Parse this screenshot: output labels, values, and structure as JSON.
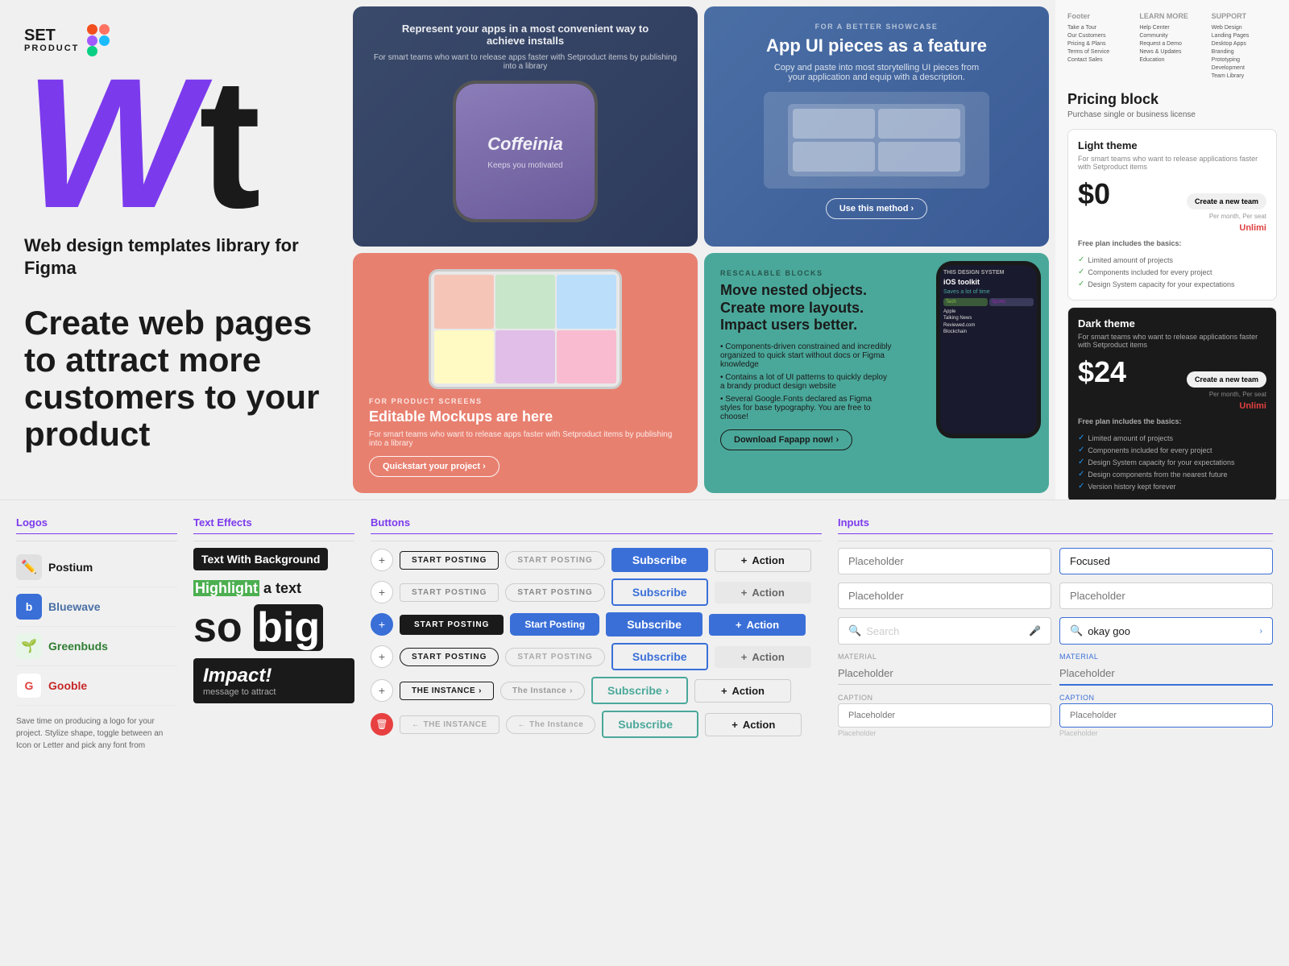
{
  "brand": {
    "name": "SET",
    "subtitle": "PRODUCT",
    "big_w": "W",
    "big_t": "t",
    "tagline": "Web design templates library for Figma",
    "cta": "Create web pages to attract more customers to your product"
  },
  "cards": [
    {
      "id": "card-apps",
      "label": "",
      "title": "Represent your apps in a most convenient way to achieve installs",
      "desc": "For smart teams who want to release apps faster with Setproduct items by publishing into a library",
      "app_name": "Coffeinia",
      "app_sub": "Keeps you motivated"
    },
    {
      "id": "card-app-feature",
      "label": "FOR A BETTER SHOWCASE",
      "title": "App UI pieces as a feature",
      "desc": "Copy and paste into most storytelling UI pieces from your application and equip with a description.",
      "button": "Use this method"
    },
    {
      "id": "card-mockups",
      "label": "FOR PRODUCT SCREENS",
      "title": "Editable Mockups are here",
      "desc": "For smart teams who want to release apps faster with Setproduct items by publishing into a library",
      "button": "Quickstart your project"
    },
    {
      "id": "card-rescalable",
      "label": "RESCALABLE BLOCKS",
      "title": "Move nested objects. Create more layouts. Impact users better.",
      "bullets": [
        "Components-driven constrained and incredibly organized to quick start without docs or Figma knowledge",
        "Contains a lot of UI patterns to quickly deploy a brandy product design website",
        "Several Google.Fonts declared as Figma styles for base typography. You are free to choose!"
      ],
      "button": "Download Fapapp now!"
    }
  ],
  "pricing": {
    "section_title": "Pricing block",
    "section_subtitle": "Purchase single or business license",
    "footer_nav": {
      "col1_title": "Footer",
      "col1_items": [
        "Take a Tour",
        "Our Customers",
        "Pricing & Plans",
        "Terms of Service",
        "Contact Sales"
      ],
      "col2_title": "LEARN MORE",
      "col2_items": [
        "Help Center",
        "Community",
        "Request a Demo",
        "News & Updates",
        "Education"
      ],
      "col3_title": "SUPPORT",
      "col3_items": [
        "Web Design",
        "Landing Pages",
        "Desktop Apps",
        "Branding",
        "Prototyping",
        "Development",
        "Team Library"
      ]
    },
    "light": {
      "title": "Light theme",
      "desc": "For smart teams who want to release applications faster with Setproduct items",
      "price": "$0",
      "cta": "Create a new team",
      "period": "Per month, Per seat",
      "plan_name": "Free plan includes the basics:",
      "features": [
        "Limited amount of projects",
        "Components included for every project",
        "Design System capacity for your expectations"
      ]
    },
    "dark": {
      "title": "Dark theme",
      "desc": "For smart teams who want to release applications faster with Setproduct items",
      "price": "$24",
      "unlimited_label": "Unlimi",
      "cta": "Create a new team",
      "period": "Per month, Per seat",
      "plan_name": "Free plan includes the basics:",
      "features": [
        "Limited amount of projects",
        "Components included for every project",
        "Design System capacity for your expectations",
        "Design components from the nearest future",
        "Version history kept forever"
      ]
    }
  },
  "logos": {
    "label": "Logos",
    "items": [
      {
        "name": "Postium",
        "icon": "✏️",
        "bg": "#e0e0e0"
      },
      {
        "name": "Bluewave",
        "icon": "b",
        "bg": "#3a6fd8",
        "color": "#fff"
      },
      {
        "name": "Greenbuds",
        "icon": "🌱",
        "bg": "#e8f5e9"
      },
      {
        "name": "Gooble",
        "icon": "G",
        "bg": "#fff",
        "color": "#e04040"
      }
    ],
    "desc": "Save time on producing a logo for your project. Stylize shape, toggle between an Icon or Letter and pick any font from"
  },
  "text_effects": {
    "label": "Text Effects",
    "items": [
      {
        "type": "bg_black",
        "text": "Text With Background"
      },
      {
        "type": "highlight",
        "highlighted": "Highlight",
        "rest": " a text"
      },
      {
        "type": "big",
        "text1": "so",
        "text2": "big"
      },
      {
        "type": "impact",
        "title": "Impact!",
        "subtitle": "message to attract"
      }
    ]
  },
  "buttons": {
    "label": "Buttons",
    "rows": [
      {
        "plus_type": "default",
        "btn1_label": "START POSTING",
        "btn1_type": "outline_sm",
        "btn2_label": "Start Posting",
        "btn2_type": "filled_light",
        "btn3_label": "Subscribe",
        "btn3_type": "subscribe_blue",
        "btn4_label": "Action",
        "btn4_type": "action_outline",
        "btn4_icon": "+"
      },
      {
        "plus_type": "default",
        "btn1_label": "START POSTING",
        "btn1_type": "outline_gray",
        "btn2_label": "Start Posting",
        "btn2_type": "filled_light_outline",
        "btn3_label": "Subscribe",
        "btn3_type": "subscribe_outline",
        "btn4_label": "Action",
        "btn4_type": "action_outline",
        "btn4_icon": "+"
      },
      {
        "plus_type": "blue",
        "btn1_label": "START POSTING",
        "btn1_type": "filled_dark",
        "btn2_label": "Start Posting",
        "btn2_type": "filled_blue",
        "btn3_label": "Subscribe",
        "btn3_type": "subscribe_blue",
        "btn4_label": "Action",
        "btn4_type": "action_blue",
        "btn4_icon": "+"
      },
      {
        "plus_type": "default",
        "btn1_label": "START POSTING",
        "btn1_type": "outline_sm_round",
        "btn2_label": "Start Posting",
        "btn2_type": "filled_light_round",
        "btn3_label": "Subscribe",
        "btn3_type": "subscribe_outline",
        "btn4_label": "Action",
        "btn4_type": "action_gray",
        "btn4_icon": "+"
      },
      {
        "plus_type": "default",
        "btn1_label": "THE INSTANCE",
        "btn1_type": "instance_outline",
        "btn1_icon": "→",
        "btn2_label": "The Instance",
        "btn2_type": "instance_light",
        "btn2_icon": "→",
        "btn3_label": "Subscribe",
        "btn3_type": "subscribe_teal",
        "btn3_icon": "→",
        "btn4_label": "Action",
        "btn4_type": "action_outline",
        "btn4_icon": "+"
      },
      {
        "plus_type": "trash",
        "btn1_label": "THE INSTANCE",
        "btn1_type": "instance_gray",
        "btn1_icon": "←",
        "btn2_label": "The Instance",
        "btn2_type": "instance_light",
        "btn2_icon": "←",
        "btn3_label": "Subscribe",
        "btn3_type": "subscribe_teal",
        "btn4_label": "Action",
        "btn4_type": "action_outline",
        "btn4_icon": "+"
      }
    ]
  },
  "inputs": {
    "label": "Inputs",
    "items": [
      {
        "type": "default",
        "placeholder": "Placeholder",
        "id": "in1"
      },
      {
        "type": "focused",
        "value": "Focused",
        "id": "in2"
      },
      {
        "type": "default",
        "placeholder": "Placeholder",
        "id": "in3"
      },
      {
        "type": "default",
        "placeholder": "Placeholder",
        "id": "in4"
      },
      {
        "type": "search",
        "placeholder": "Search",
        "id": "in5"
      },
      {
        "type": "search_active",
        "value": "okay goo",
        "id": "in6"
      },
      {
        "type": "material",
        "label": "MATERIAL",
        "placeholder": "Placeholder",
        "id": "in7"
      },
      {
        "type": "material_active",
        "label": "MATERIAL",
        "placeholder": "Placeholder",
        "id": "in8"
      },
      {
        "type": "caption",
        "label": "Caption",
        "placeholder": "Placeholder",
        "id": "in9"
      },
      {
        "type": "caption_active",
        "label": "Caption",
        "placeholder": "Placeholder",
        "id": "in10"
      }
    ]
  }
}
